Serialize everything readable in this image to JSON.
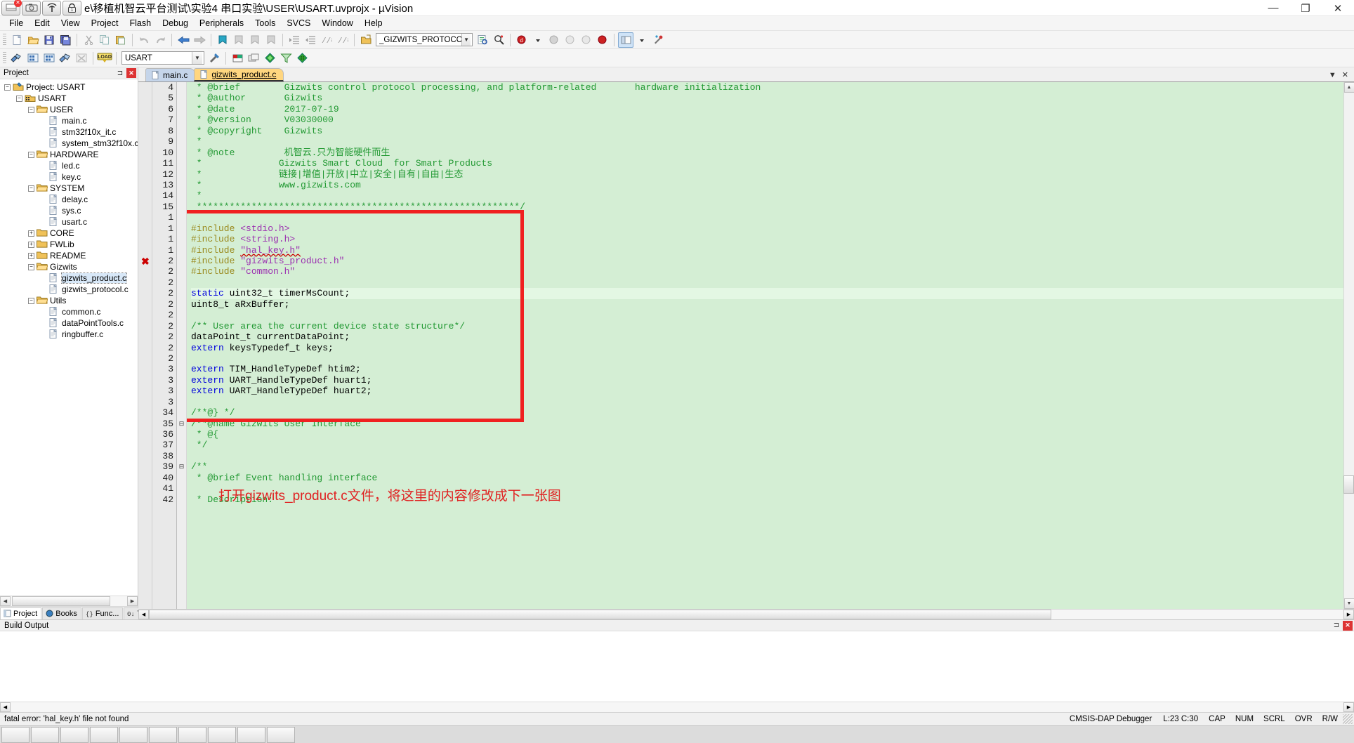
{
  "window": {
    "title": "e\\移植机智云平台测试\\实验4 串口实验\\USER\\USART.uvprojx - µVision",
    "minimize": "—",
    "maximize": "❐",
    "close": "✕",
    "overlay_icons": [
      "screen-share-icon",
      "camera-icon",
      "wifi-icon",
      "lock-icon"
    ],
    "lock_badge": "1"
  },
  "menu": {
    "items": [
      "File",
      "Edit",
      "View",
      "Project",
      "Flash",
      "Debug",
      "Peripherals",
      "Tools",
      "SVCS",
      "Window",
      "Help"
    ]
  },
  "toolbar_main": {
    "buttons": [
      "new-file-icon",
      "open-file-icon",
      "save-icon",
      "save-all-icon",
      "cut-icon",
      "copy-icon",
      "paste-icon",
      "undo-icon",
      "redo-icon",
      "navigate-back-icon",
      "navigate-forward-icon",
      "bookmark-toggle-icon",
      "bookmark-prev-icon",
      "bookmark-next-icon",
      "bookmark-clear-icon",
      "indent-icon",
      "outdent-icon",
      "comment-icon",
      "uncomment-icon",
      "debug-session-icon"
    ],
    "search_combo_value": "_GIZWITS_PROTOCOL_H",
    "after_buttons": [
      "find-in-files-icon",
      "find-next-icon",
      "configure-icon"
    ],
    "breakpoint_icons": [
      "insert-breakpoint-icon",
      "kill-breakpoints-icon",
      "disable-breakpoint-icon",
      "enable-breakpoints-icon"
    ],
    "window_icons": [
      "project-window-icon",
      "settings-icon"
    ]
  },
  "toolbar_build": {
    "buttons": [
      "translate-icon",
      "build-icon",
      "rebuild-icon",
      "batch-build-icon",
      "stop-build-icon",
      "download-icon"
    ],
    "target_combo_value": "USART",
    "right_buttons": [
      "target-options-icon",
      "manage-project-icon",
      "manage-runtime-icon",
      "pack-installer-icon",
      "multi-project-icon",
      "filter-icon",
      "components-icon"
    ]
  },
  "project_panel": {
    "title": "Project",
    "pin_icon": "pin-icon",
    "close_icon": "close-icon",
    "tree": [
      {
        "label": "Project: USART",
        "depth": 0,
        "expander": "−",
        "icon": "project-icon",
        "selected": false
      },
      {
        "label": "USART",
        "depth": 1,
        "expander": "−",
        "icon": "target-icon",
        "selected": false
      },
      {
        "label": "USER",
        "depth": 2,
        "expander": "−",
        "icon": "folder-open-icon",
        "selected": false
      },
      {
        "label": "main.c",
        "depth": 3,
        "expander": "",
        "icon": "c-file-icon",
        "selected": false
      },
      {
        "label": "stm32f10x_it.c",
        "depth": 3,
        "expander": "",
        "icon": "c-file-icon",
        "selected": false
      },
      {
        "label": "system_stm32f10x.c",
        "depth": 3,
        "expander": "",
        "icon": "c-file-icon",
        "selected": false
      },
      {
        "label": "HARDWARE",
        "depth": 2,
        "expander": "−",
        "icon": "folder-open-icon",
        "selected": false
      },
      {
        "label": "led.c",
        "depth": 3,
        "expander": "",
        "icon": "c-file-icon",
        "selected": false
      },
      {
        "label": "key.c",
        "depth": 3,
        "expander": "",
        "icon": "c-file-icon",
        "selected": false
      },
      {
        "label": "SYSTEM",
        "depth": 2,
        "expander": "−",
        "icon": "folder-open-icon",
        "selected": false
      },
      {
        "label": "delay.c",
        "depth": 3,
        "expander": "",
        "icon": "c-file-icon",
        "selected": false
      },
      {
        "label": "sys.c",
        "depth": 3,
        "expander": "",
        "icon": "c-file-icon",
        "selected": false
      },
      {
        "label": "usart.c",
        "depth": 3,
        "expander": "",
        "icon": "c-file-icon",
        "selected": false
      },
      {
        "label": "CORE",
        "depth": 2,
        "expander": "+",
        "icon": "folder-closed-icon",
        "selected": false
      },
      {
        "label": "FWLib",
        "depth": 2,
        "expander": "+",
        "icon": "folder-closed-icon",
        "selected": false
      },
      {
        "label": "README",
        "depth": 2,
        "expander": "+",
        "icon": "folder-closed-icon",
        "selected": false
      },
      {
        "label": "Gizwits",
        "depth": 2,
        "expander": "−",
        "icon": "folder-open-icon",
        "selected": false
      },
      {
        "label": "gizwits_product.c",
        "depth": 3,
        "expander": "",
        "icon": "c-file-icon",
        "selected": true
      },
      {
        "label": "gizwits_protocol.c",
        "depth": 3,
        "expander": "",
        "icon": "c-file-icon",
        "selected": false
      },
      {
        "label": "Utils",
        "depth": 2,
        "expander": "−",
        "icon": "folder-open-icon",
        "selected": false
      },
      {
        "label": "common.c",
        "depth": 3,
        "expander": "",
        "icon": "c-file-icon",
        "selected": false
      },
      {
        "label": "dataPointTools.c",
        "depth": 3,
        "expander": "",
        "icon": "c-file-icon",
        "selected": false
      },
      {
        "label": "ringbuffer.c",
        "depth": 3,
        "expander": "",
        "icon": "c-file-icon",
        "selected": false
      }
    ],
    "tabs": [
      {
        "label": "Project",
        "icon": "project-tab-icon",
        "active": true
      },
      {
        "label": "Books",
        "icon": "books-tab-icon",
        "active": false
      },
      {
        "label": "Func...",
        "icon": "functions-tab-icon",
        "active": false
      },
      {
        "label": "Temp...",
        "icon": "templates-tab-icon",
        "active": false
      }
    ]
  },
  "editor": {
    "tabs": [
      {
        "label": "main.c",
        "active": false,
        "icon": "c-file-icon"
      },
      {
        "label": "gizwits_product.c",
        "active": true,
        "icon": "c-file-icon"
      }
    ],
    "tab_controls": [
      "chevron-down-icon",
      "close-icon"
    ],
    "lines": [
      {
        "n": "4",
        "tokens": [
          {
            "t": "cmt",
            "s": " * @brief        Gizwits control protocol processing, and platform-related       hardware initialization"
          }
        ]
      },
      {
        "n": "5",
        "tokens": [
          {
            "t": "cmt",
            "s": " * @author       Gizwits"
          }
        ]
      },
      {
        "n": "6",
        "tokens": [
          {
            "t": "cmt",
            "s": " * @date         2017-07-19"
          }
        ]
      },
      {
        "n": "7",
        "tokens": [
          {
            "t": "cmt",
            "s": " * @version      V03030000"
          }
        ]
      },
      {
        "n": "8",
        "tokens": [
          {
            "t": "cmt",
            "s": " * @copyright    Gizwits"
          }
        ]
      },
      {
        "n": "9",
        "tokens": [
          {
            "t": "cmt",
            "s": " *"
          }
        ]
      },
      {
        "n": "10",
        "tokens": [
          {
            "t": "cmt",
            "s": " * @note         机智云.只为智能硬件而生"
          }
        ]
      },
      {
        "n": "11",
        "tokens": [
          {
            "t": "cmt",
            "s": " *              Gizwits Smart Cloud  for Smart Products"
          }
        ]
      },
      {
        "n": "12",
        "tokens": [
          {
            "t": "cmt",
            "s": " *              链接|增值|开放|中立|安全|自有|自由|生态"
          }
        ]
      },
      {
        "n": "13",
        "tokens": [
          {
            "t": "cmt",
            "s": " *              www.gizwits.com"
          }
        ]
      },
      {
        "n": "14",
        "tokens": [
          {
            "t": "cmt",
            "s": " *"
          }
        ]
      },
      {
        "n": "15",
        "tokens": [
          {
            "t": "cmt",
            "s": " ***********************************************************/"
          }
        ]
      },
      {
        "n": "1",
        "tokens": [
          {
            "t": "txt",
            "s": ""
          }
        ]
      },
      {
        "n": "1",
        "tokens": [
          {
            "t": "pp",
            "s": "#include "
          },
          {
            "t": "str",
            "s": "<stdio.h>"
          }
        ]
      },
      {
        "n": "1",
        "tokens": [
          {
            "t": "pp",
            "s": "#include "
          },
          {
            "t": "str",
            "s": "<string.h>"
          }
        ]
      },
      {
        "n": "1",
        "tokens": [
          {
            "t": "pp",
            "s": "#include "
          },
          {
            "t": "str",
            "s": "\"hal_key.h\"",
            "sq": true
          }
        ]
      },
      {
        "n": "2",
        "tokens": [
          {
            "t": "pp",
            "s": "#include "
          },
          {
            "t": "str",
            "s": "\"gizwits_product.h\""
          }
        ]
      },
      {
        "n": "2",
        "tokens": [
          {
            "t": "pp",
            "s": "#include "
          },
          {
            "t": "str",
            "s": "\"common.h\""
          }
        ]
      },
      {
        "n": "2",
        "tokens": [
          {
            "t": "txt",
            "s": ""
          }
        ]
      },
      {
        "n": "2",
        "hl": true,
        "tokens": [
          {
            "t": "kw",
            "s": "static"
          },
          {
            "t": "txt",
            "s": " uint32_t timerMsCount;"
          }
        ]
      },
      {
        "n": "2",
        "tokens": [
          {
            "t": "txt",
            "s": "uint8_t aRxBuffer;"
          }
        ]
      },
      {
        "n": "2",
        "tokens": [
          {
            "t": "txt",
            "s": ""
          }
        ]
      },
      {
        "n": "2",
        "tokens": [
          {
            "t": "cmt",
            "s": "/** User area the current device state structure*/"
          }
        ]
      },
      {
        "n": "2",
        "tokens": [
          {
            "t": "txt",
            "s": "dataPoint_t currentDataPoint;"
          }
        ]
      },
      {
        "n": "2",
        "tokens": [
          {
            "t": "kw",
            "s": "extern"
          },
          {
            "t": "txt",
            "s": " keysTypedef_t keys;"
          }
        ]
      },
      {
        "n": "2",
        "tokens": [
          {
            "t": "txt",
            "s": ""
          }
        ]
      },
      {
        "n": "3",
        "tokens": [
          {
            "t": "kw",
            "s": "extern"
          },
          {
            "t": "txt",
            "s": " TIM_HandleTypeDef htim2;"
          }
        ]
      },
      {
        "n": "3",
        "tokens": [
          {
            "t": "kw",
            "s": "extern"
          },
          {
            "t": "txt",
            "s": " UART_HandleTypeDef huart1;"
          }
        ]
      },
      {
        "n": "3",
        "tokens": [
          {
            "t": "kw",
            "s": "extern"
          },
          {
            "t": "txt",
            "s": " UART_HandleTypeDef huart2;"
          }
        ]
      },
      {
        "n": "3",
        "tokens": [
          {
            "t": "txt",
            "s": ""
          }
        ]
      },
      {
        "n": "34",
        "tokens": [
          {
            "t": "cmt",
            "s": "/**@} */"
          }
        ]
      },
      {
        "n": "35",
        "fold": true,
        "tokens": [
          {
            "t": "cmt",
            "s": "/**@name Gizwits User Interface"
          }
        ]
      },
      {
        "n": "36",
        "tokens": [
          {
            "t": "cmt",
            "s": " * @{"
          }
        ]
      },
      {
        "n": "37",
        "tokens": [
          {
            "t": "cmt",
            "s": " */"
          }
        ]
      },
      {
        "n": "38",
        "tokens": [
          {
            "t": "txt",
            "s": ""
          }
        ]
      },
      {
        "n": "39",
        "fold": true,
        "tokens": [
          {
            "t": "cmt",
            "s": "/**"
          }
        ]
      },
      {
        "n": "40",
        "tokens": [
          {
            "t": "cmt",
            "s": " * @brief Event handling interface"
          }
        ]
      },
      {
        "n": "41",
        "tokens": [
          {
            "t": "txt",
            "s": ""
          }
        ]
      },
      {
        "n": "42",
        "tokens": [
          {
            "t": "cmt",
            "s": " * Description:"
          }
        ]
      }
    ],
    "annotation": "打开gizwits_product.c文件，将这里的内容修改成下一张图",
    "annotation_color": "#e02020",
    "redbox_color": "#f02020"
  },
  "build_output": {
    "title": "Build Output",
    "pin_icon": "pin-icon",
    "close_icon": "close-icon",
    "content": ""
  },
  "status_bar": {
    "message": "fatal error: 'hal_key.h' file not found",
    "debugger": "CMSIS-DAP Debugger",
    "cursor": "L:23 C:30",
    "indicators": [
      "CAP",
      "NUM",
      "SCRL",
      "OVR",
      "R/W"
    ]
  },
  "taskbar": {
    "items": [
      "taskbar-item-1",
      "taskbar-item-2",
      "taskbar-item-3",
      "taskbar-item-4",
      "taskbar-item-5",
      "taskbar-item-6",
      "taskbar-item-7",
      "taskbar-item-8",
      "taskbar-item-9",
      "taskbar-item-10"
    ]
  }
}
